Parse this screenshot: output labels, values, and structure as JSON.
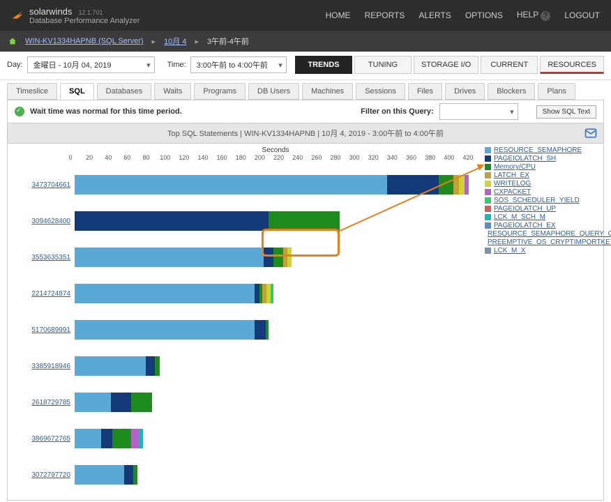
{
  "brand": {
    "main": "solarwinds",
    "sub": "Database Performance Analyzer",
    "version": "12.1.701"
  },
  "nav": {
    "home": "HOME",
    "reports": "REPORTS",
    "alerts": "ALERTS",
    "options": "OPTIONS",
    "help": "HELP",
    "logout": "LOGOUT"
  },
  "crumbs": {
    "server": "WIN-KV1334HAPNB (SQL Server)",
    "day": "10月 4",
    "range": "3午前-4午前"
  },
  "controls": {
    "day_label": "Day:",
    "day_value": "金曜日 - 10月 04, 2019",
    "time_label": "Time:",
    "time_value": "3:00午前 to 4:00午前"
  },
  "maintabs": {
    "trends": "TRENDS",
    "tuning": "TUNING",
    "storage": "STORAGE I/O",
    "current": "CURRENT",
    "resources": "RESOURCES"
  },
  "subtabs": {
    "timeslice": "Timeslice",
    "sql": "SQL",
    "databases": "Databases",
    "waits": "Waits",
    "programs": "Programs",
    "dbusers": "DB Users",
    "machines": "Machines",
    "sessions": "Sessions",
    "files": "Files",
    "drives": "Drives",
    "blockers": "Blockers",
    "plans": "Plans"
  },
  "status_msg": "Wait time was normal for this time period.",
  "filter_label": "Filter on this Query:",
  "show_sql_btn": "Show SQL Text",
  "chart_title": "Top SQL Statements   |   WIN-KV1334HAPNB   |   10月 4, 2019 - 3:00午前 to 4:00午前",
  "chart_data": {
    "type": "bar",
    "xlabel": "Seconds",
    "xlim": [
      0,
      420
    ],
    "ticks": [
      0,
      20,
      40,
      60,
      80,
      100,
      120,
      140,
      160,
      180,
      200,
      220,
      240,
      260,
      280,
      300,
      320,
      340,
      360,
      380,
      400,
      420
    ],
    "wait_types": [
      {
        "name": "RESOURCE_SEMAPHORE",
        "color": "#5aa8d6"
      },
      {
        "name": "PAGEIOLATCH_SH",
        "color": "#143a7a"
      },
      {
        "name": "Memory/CPU",
        "color": "#1e8b1e"
      },
      {
        "name": "LATCH_EX",
        "color": "#c2a03a"
      },
      {
        "name": "WRITELOG",
        "color": "#d0d330"
      },
      {
        "name": "CXPACKET",
        "color": "#b562c6"
      },
      {
        "name": "SOS_SCHEDULER_YIELD",
        "color": "#33cc66"
      },
      {
        "name": "PAGEIOLATCH_UP",
        "color": "#d85a5a"
      },
      {
        "name": "LCK_M_SCH_M",
        "color": "#1ab8b8"
      },
      {
        "name": "PAGEIOLATCH_EX",
        "color": "#5b8ec1"
      },
      {
        "name": "RESOURCE_SEMAPHORE_QUERY_COMPILE",
        "color": "#e9b98e"
      },
      {
        "name": "PREEMPTIVE_OS_CRYPTIMPORTKEY",
        "color": "#2e6dd1"
      },
      {
        "name": "LCK_M_X",
        "color": "#7a94b0"
      }
    ],
    "series": [
      {
        "id": "3473704661",
        "segments": [
          {
            "w": "RESOURCE_SEMAPHORE",
            "v": 330
          },
          {
            "w": "PAGEIOLATCH_SH",
            "v": 55
          },
          {
            "w": "Memory/CPU",
            "v": 15
          },
          {
            "w": "LATCH_EX",
            "v": 6
          },
          {
            "w": "WRITELOG",
            "v": 6
          },
          {
            "w": "CXPACKET",
            "v": 4
          }
        ]
      },
      {
        "id": "3094628400",
        "segments": [
          {
            "w": "PAGEIOLATCH_SH",
            "v": 205
          },
          {
            "w": "Memory/CPU",
            "v": 75
          }
        ]
      },
      {
        "id": "3553635351",
        "segments": [
          {
            "w": "RESOURCE_SEMAPHORE",
            "v": 200
          },
          {
            "w": "PAGEIOLATCH_SH",
            "v": 10
          },
          {
            "w": "Memory/CPU",
            "v": 10
          },
          {
            "w": "LATCH_EX",
            "v": 5
          },
          {
            "w": "WRITELOG",
            "v": 4
          }
        ]
      },
      {
        "id": "2214724874",
        "segments": [
          {
            "w": "RESOURCE_SEMAPHORE",
            "v": 190
          },
          {
            "w": "PAGEIOLATCH_SH",
            "v": 5
          },
          {
            "w": "Memory/CPU",
            "v": 3
          },
          {
            "w": "LATCH_EX",
            "v": 5
          },
          {
            "w": "WRITELOG",
            "v": 4
          },
          {
            "w": "SOS_SCHEDULER_YIELD",
            "v": 3
          }
        ]
      },
      {
        "id": "5170689991",
        "segments": [
          {
            "w": "RESOURCE_SEMAPHORE",
            "v": 190
          },
          {
            "w": "PAGEIOLATCH_SH",
            "v": 12
          },
          {
            "w": "Memory/CPU",
            "v": 3
          }
        ]
      },
      {
        "id": "3385918946",
        "segments": [
          {
            "w": "RESOURCE_SEMAPHORE",
            "v": 75
          },
          {
            "w": "PAGEIOLATCH_SH",
            "v": 10
          },
          {
            "w": "Memory/CPU",
            "v": 5
          }
        ]
      },
      {
        "id": "2618729785",
        "segments": [
          {
            "w": "RESOURCE_SEMAPHORE",
            "v": 38
          },
          {
            "w": "PAGEIOLATCH_SH",
            "v": 22
          },
          {
            "w": "Memory/CPU",
            "v": 22
          }
        ]
      },
      {
        "id": "3869672765",
        "segments": [
          {
            "w": "RESOURCE_SEMAPHORE",
            "v": 28
          },
          {
            "w": "PAGEIOLATCH_SH",
            "v": 12
          },
          {
            "w": "Memory/CPU",
            "v": 20
          },
          {
            "w": "CXPACKET",
            "v": 8
          },
          {
            "w": "LCK_M_SCH_M",
            "v": 4
          }
        ]
      },
      {
        "id": "3072797720",
        "segments": [
          {
            "w": "RESOURCE_SEMAPHORE",
            "v": 52
          },
          {
            "w": "PAGEIOLATCH_SH",
            "v": 10
          },
          {
            "w": "Memory/CPU",
            "v": 4
          }
        ]
      }
    ]
  }
}
